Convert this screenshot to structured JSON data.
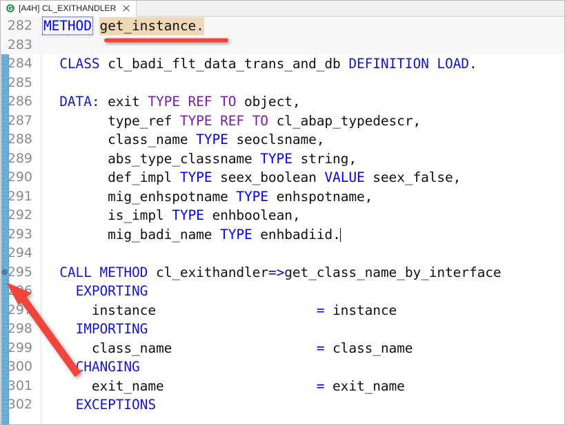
{
  "window": {
    "title": "[A4H] CL_EXITHANDLER"
  },
  "tab": {
    "label": "[A4H] CL_EXITHANDLER",
    "icon": "class-green-circle-icon",
    "close_icon": "close-icon",
    "close_glyph": "×"
  },
  "editor": {
    "language": "ABAP",
    "caret_line": 293,
    "current_line": 282,
    "marker_line": 295,
    "fold_glyph": "⊖",
    "colors": {
      "keyword": "#0000ef",
      "type_keyword": "#7a1fa2",
      "occurrence_highlight": "#eed9b4",
      "current_line": "#f7f7f7",
      "line_number": "#8a8a8a",
      "change_bar": "#2d7fc4",
      "annotation_red": "#f0443c"
    }
  },
  "code": {
    "lines": [
      {
        "num": "282",
        "fold": true,
        "current": true,
        "text": "METHOD get_instance."
      },
      {
        "num": "283",
        "fold": false,
        "current": true,
        "text": ""
      },
      {
        "num": "284",
        "fold": false,
        "current": false,
        "text": "  CLASS cl_badi_flt_data_trans_and_db DEFINITION LOAD."
      },
      {
        "num": "285",
        "fold": false,
        "current": false,
        "text": ""
      },
      {
        "num": "286",
        "fold": false,
        "current": false,
        "text": "  DATA: exit TYPE REF TO object,"
      },
      {
        "num": "287",
        "fold": false,
        "current": false,
        "text": "        type_ref TYPE REF TO cl_abap_typedescr,"
      },
      {
        "num": "288",
        "fold": false,
        "current": false,
        "text": "        class_name TYPE seoclsname,"
      },
      {
        "num": "289",
        "fold": false,
        "current": false,
        "text": "        abs_type_classname TYPE string,"
      },
      {
        "num": "290",
        "fold": false,
        "current": false,
        "text": "        def_impl TYPE seex_boolean VALUE seex_false,"
      },
      {
        "num": "291",
        "fold": false,
        "current": false,
        "text": "        mig_enhspotname TYPE enhspotname,"
      },
      {
        "num": "292",
        "fold": false,
        "current": false,
        "text": "        is_impl TYPE enhboolean,"
      },
      {
        "num": "293",
        "fold": false,
        "current": false,
        "text": "        mig_badi_name TYPE enhbadiid."
      },
      {
        "num": "294",
        "fold": false,
        "current": false,
        "text": ""
      },
      {
        "num": "295",
        "fold": false,
        "current": false,
        "text": "  CALL METHOD cl_exithandler=>get_class_name_by_interface"
      },
      {
        "num": "296",
        "fold": false,
        "current": false,
        "text": "    EXPORTING"
      },
      {
        "num": "297",
        "fold": false,
        "current": false,
        "text": "      instance                    = instance"
      },
      {
        "num": "298",
        "fold": false,
        "current": false,
        "text": "    IMPORTING"
      },
      {
        "num": "299",
        "fold": false,
        "current": false,
        "text": "      class_name                  = class_name"
      },
      {
        "num": "300",
        "fold": false,
        "current": false,
        "text": "    CHANGING"
      },
      {
        "num": "301",
        "fold": false,
        "current": false,
        "text": "      exit_name                   = exit_name"
      },
      {
        "num": "302",
        "fold": false,
        "current": false,
        "text": "    EXCEPTIONS"
      }
    ]
  },
  "annotations": {
    "underline": {
      "name": "red-underline",
      "target_text": "get_instance."
    },
    "arrow": {
      "name": "red-arrow",
      "points_to_line": "295"
    }
  }
}
